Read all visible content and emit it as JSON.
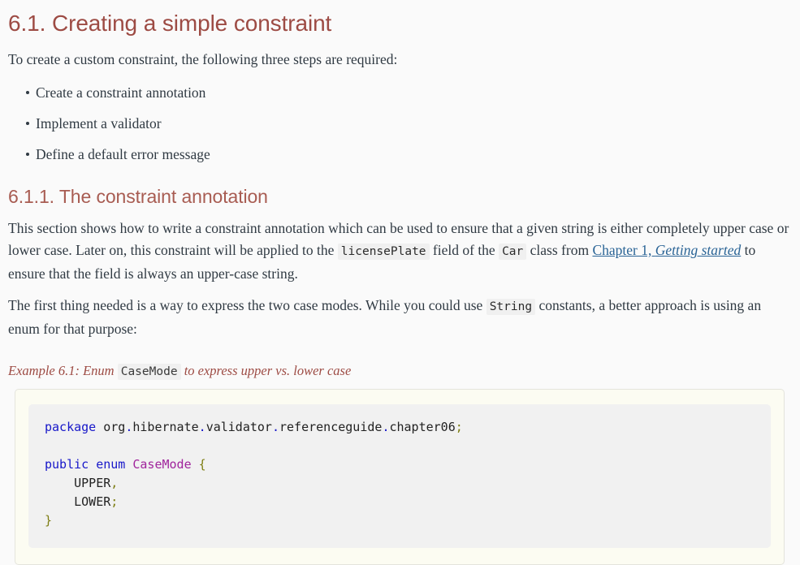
{
  "section": {
    "title": "6.1. Creating a simple constraint",
    "intro": "To create a custom constraint, the following three steps are required:",
    "steps": [
      "Create a constraint annotation",
      "Implement a validator",
      "Define a default error message"
    ]
  },
  "subsection": {
    "title": "6.1.1. The constraint annotation",
    "paragraph1": {
      "part1": "This section shows how to write a constraint annotation which can be used to ensure that a given string is either completely upper case or lower case. Later on, this constraint will be applied to the ",
      "code1": "licensePlate",
      "part2": " field of the ",
      "code2": "Car",
      "part3": " class from ",
      "link_prefix": "Chapter 1, ",
      "link_italic": "Getting started",
      "part4": " to ensure that the field is always an upper-case string."
    },
    "paragraph2": {
      "part1": "The first thing needed is a way to express the two case modes. While you could use ",
      "code1": "String",
      "part2": " constants, a better approach is using an enum for that purpose:"
    }
  },
  "example": {
    "caption_prefix": "Example 6.1: Enum ",
    "caption_code": "CaseMode",
    "caption_suffix": " to express upper vs. lower case",
    "code": {
      "line1_keyword": "package",
      "line1_path_a": "org",
      "line1_dot1": ".",
      "line1_path_b": "hibernate",
      "line1_dot2": ".",
      "line1_path_c": "validator",
      "line1_dot3": ".",
      "line1_path_d": "referenceguide",
      "line1_dot4": ".",
      "line1_path_e": "chapter06",
      "line1_semi": ";",
      "line3_keyword1": "public",
      "line3_keyword2": "enum",
      "line3_type": "CaseMode",
      "line3_brace": "{",
      "line4_const": "UPPER",
      "line4_comma": ",",
      "line5_const": "LOWER",
      "line5_semi": ";",
      "line6_brace": "}"
    }
  },
  "colors": {
    "heading": "#9d4b44",
    "subheading": "#a85c52",
    "link": "#2a6496",
    "body_text": "#303a43",
    "code_panel_bg": "#fcfcf2",
    "code_block_bg": "#f1f1f1",
    "keyword": "#1717c9",
    "type": "#a0249c",
    "punct": "#7d7d12",
    "page_bg": "#fafafa"
  }
}
